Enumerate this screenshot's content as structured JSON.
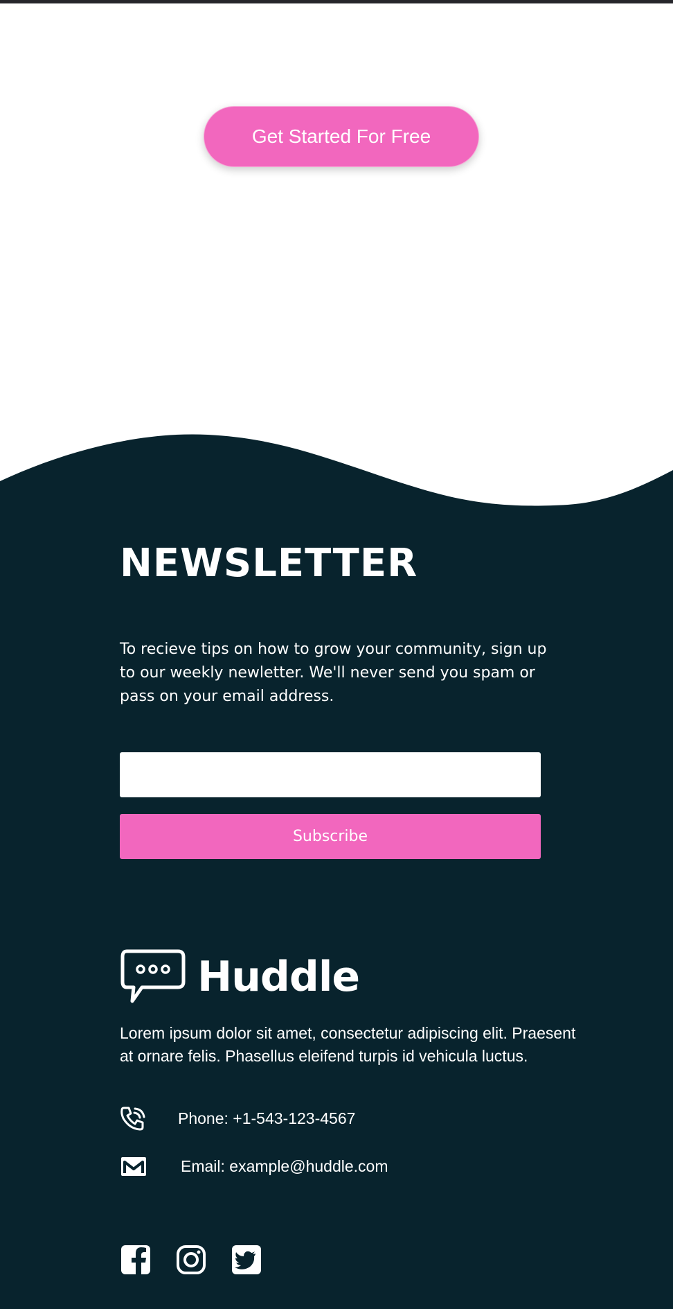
{
  "cta": {
    "label": "Get Started For Free"
  },
  "newsletter": {
    "title": "NEWSLETTER",
    "description": "To recieve tips on how to grow your community, sign up to our weekly newletter. We'll never send you spam or pass on your email address.",
    "email_placeholder": "",
    "subscribe_label": "Subscribe"
  },
  "footer": {
    "brand": "Huddle",
    "about": "Lorem ipsum dolor sit amet, consectetur adipiscing elit. Praesent at ornare felis. Phasellus eleifend turpis id vehicula luctus.",
    "phone": "Phone: +1-543-123-4567",
    "email": "Email: example@huddle.com",
    "socials": [
      "facebook-icon",
      "instagram-icon",
      "twitter-icon"
    ]
  },
  "colors": {
    "accent": "#f267be",
    "footer_bg": "#08232d",
    "page_bg": "#ffffff"
  }
}
